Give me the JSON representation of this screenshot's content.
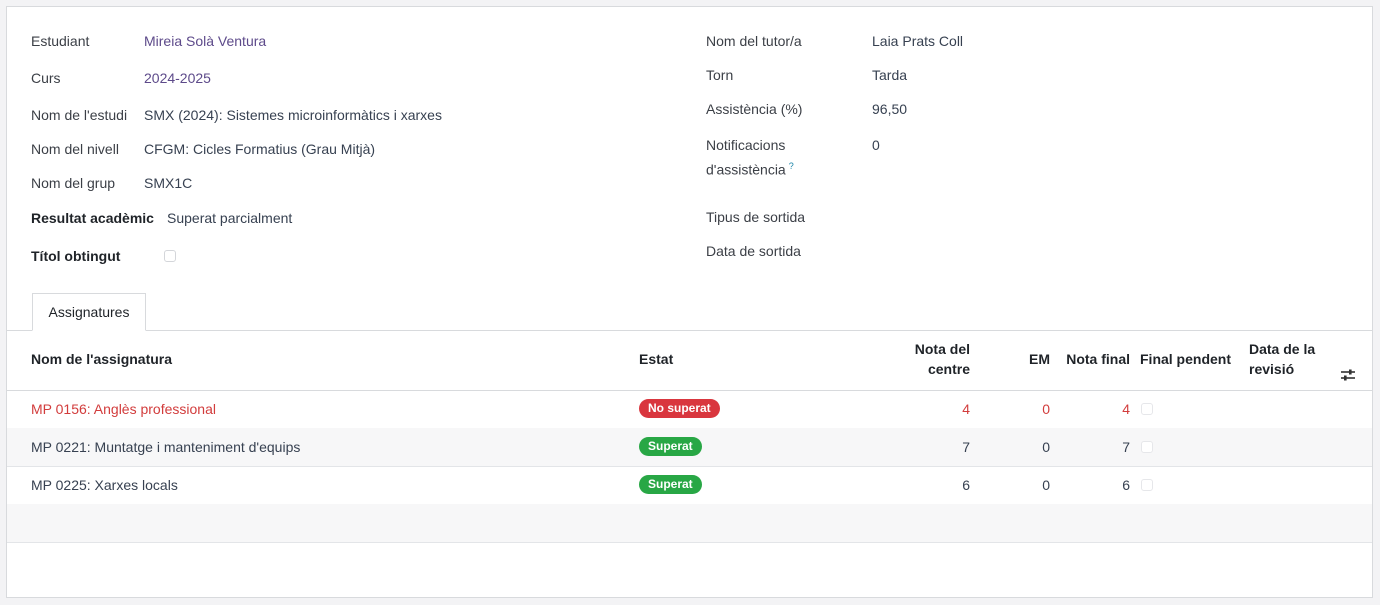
{
  "student": {
    "estudiant_label": "Estudiant",
    "estudiant_value": "Mireia Solà Ventura",
    "curs_label": "Curs",
    "curs_value": "2024-2025",
    "estudi_label": "Nom de l'estudi",
    "estudi_value": "SMX (2024): Sistemes microinformàtics i xarxes",
    "nivell_label": "Nom del nivell",
    "nivell_value": "CFGM: Cicles Formatius (Grau Mitjà)",
    "grup_label": "Nom del grup",
    "grup_value": "SMX1C",
    "resultat_label": "Resultat acadèmic",
    "resultat_value": "Superat parcialment",
    "titol_label": "Títol obtingut"
  },
  "right": {
    "tutor_label": "Nom del tutor/a",
    "tutor_value": "Laia Prats Coll",
    "torn_label": "Torn",
    "torn_value": "Tarda",
    "assist_label": "Assistència (%)",
    "assist_value": "96,50",
    "notif_label_1": "Notificacions",
    "notif_label_2": "d'assistència",
    "notif_help": "?",
    "notif_value": "0",
    "tipus_label": "Tipus de sortida",
    "data_label": "Data de sortida"
  },
  "tabs": {
    "assignatures": "Assignatures"
  },
  "table": {
    "headers": {
      "nom": "Nom de l'assignatura",
      "estat": "Estat",
      "nota_centre_1": "Nota del",
      "nota_centre_2": "centre",
      "em": "EM",
      "nota_final": "Nota final",
      "final_pendent": "Final pendent",
      "data_rev_1": "Data de la",
      "data_rev_2": "revisió",
      "settings_icon": "sliders-icon"
    },
    "rows": [
      {
        "nom": "MP 0156: Anglès professional",
        "estat": "No superat",
        "nota_centre": "4",
        "em": "0",
        "nota_final": "4"
      },
      {
        "nom": "MP 0221: Muntatge i manteniment d'equips",
        "estat": "Superat",
        "nota_centre": "7",
        "em": "0",
        "nota_final": "7"
      },
      {
        "nom": "MP 0225: Xarxes locals",
        "estat": "Superat",
        "nota_centre": "6",
        "em": "0",
        "nota_final": "6"
      }
    ]
  },
  "colors": {
    "fail": "#d9363e",
    "pass": "#28a745",
    "link": "#5d4a8a"
  }
}
